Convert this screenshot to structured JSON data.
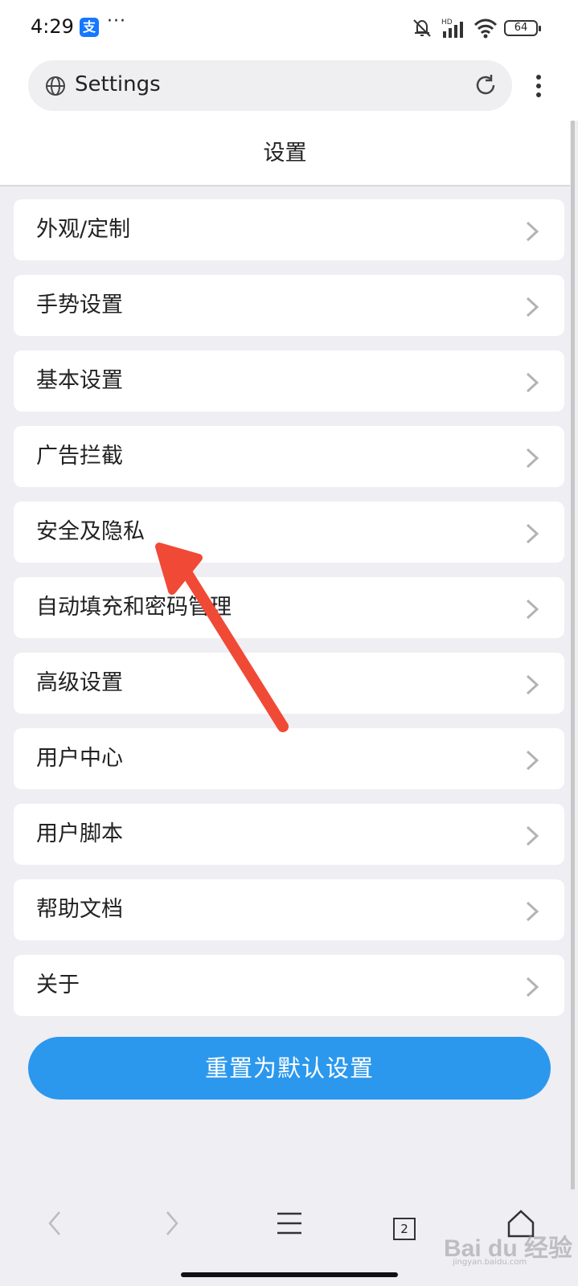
{
  "status_bar": {
    "time": "4:29",
    "app_badge": "支",
    "more": "···",
    "network": "HD",
    "battery": "64"
  },
  "address_bar": {
    "text": "Settings",
    "icons": [
      "globe-icon",
      "reload-icon",
      "more-vertical-icon"
    ]
  },
  "page": {
    "title": "设置"
  },
  "settings_items": [
    {
      "label": "外观/定制"
    },
    {
      "label": "手势设置"
    },
    {
      "label": "基本设置"
    },
    {
      "label": "广告拦截"
    },
    {
      "label": "安全及隐私"
    },
    {
      "label": "自动填充和密码管理"
    },
    {
      "label": "高级设置"
    },
    {
      "label": "用户中心"
    },
    {
      "label": "用户脚本"
    },
    {
      "label": "帮助文档"
    },
    {
      "label": "关于"
    }
  ],
  "reset_button": {
    "label": "重置为默认设置"
  },
  "bottom_nav": {
    "tab_count": "2",
    "icons": [
      "back-icon",
      "forward-icon",
      "menu-icon",
      "tabs-icon",
      "home-icon"
    ]
  },
  "watermark": {
    "text": "Bai du 经验",
    "sub": "jingyan.baidu.com"
  },
  "colors": {
    "accent": "#2b98ee",
    "background": "#efeef3",
    "arrow": "#f04a36"
  }
}
